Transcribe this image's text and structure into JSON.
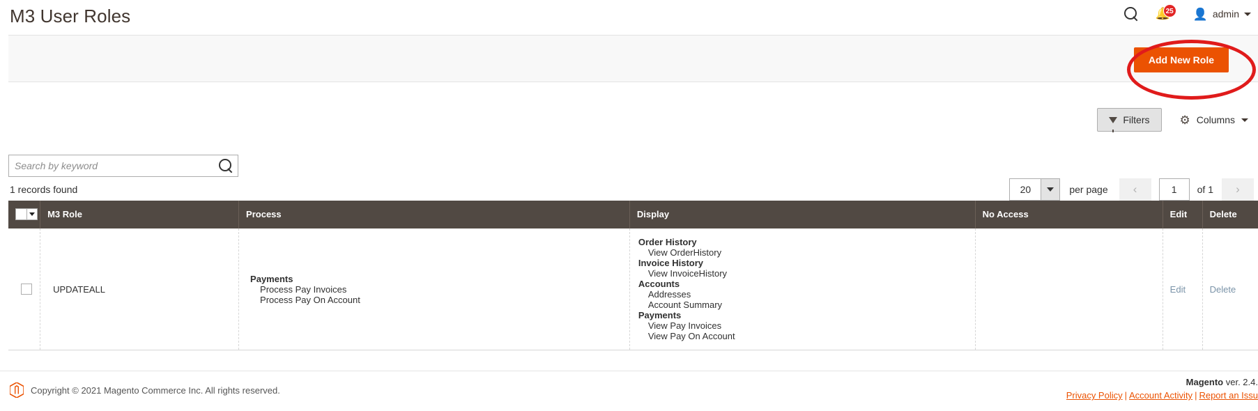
{
  "header": {
    "title": "M3 User Roles",
    "search_icon": "search-icon",
    "notifications": {
      "icon": "bell-icon",
      "count": "25"
    },
    "user": {
      "avatar_icon": "user-avatar-icon",
      "name": "admin",
      "caret_icon": "chevron-down-icon"
    }
  },
  "page_actions": {
    "add_new_role_label": "Add New Role",
    "accent_color": "#eb5202",
    "annotation_color": "#e01b1b"
  },
  "grid_controls": {
    "filters_label": "Filters",
    "filters_icon": "funnel-icon",
    "columns_label": "Columns",
    "columns_icon": "gear-icon",
    "columns_caret_icon": "chevron-down-icon"
  },
  "search": {
    "placeholder": "Search by keyword",
    "value": "",
    "submit_icon": "search-icon"
  },
  "toolbar": {
    "records_found": "1 records found",
    "per_page_value": "20",
    "per_page_label": "per page",
    "prev_icon": "chevron-left-icon",
    "next_icon": "chevron-right-icon",
    "current_page": "1",
    "of_label": "of 1"
  },
  "table": {
    "columns": [
      {
        "key": "checkbox",
        "label": ""
      },
      {
        "key": "role",
        "label": "M3 Role"
      },
      {
        "key": "process",
        "label": "Process"
      },
      {
        "key": "display",
        "label": "Display"
      },
      {
        "key": "no_access",
        "label": "No Access"
      },
      {
        "key": "edit",
        "label": "Edit"
      },
      {
        "key": "delete",
        "label": "Delete"
      }
    ],
    "rows": [
      {
        "role": "UPDATEALL",
        "process": [
          {
            "group": "Payments",
            "items": [
              "Process Pay Invoices",
              "Process Pay On Account"
            ]
          }
        ],
        "display": [
          {
            "group": "Order History",
            "items": [
              "View OrderHistory"
            ]
          },
          {
            "group": "Invoice History",
            "items": [
              "View InvoiceHistory"
            ]
          },
          {
            "group": "Accounts",
            "items": [
              "Addresses",
              "Account Summary"
            ]
          },
          {
            "group": "Payments",
            "items": [
              "View Pay Invoices",
              "View Pay On Account"
            ]
          }
        ],
        "no_access": [],
        "edit_label": "Edit",
        "delete_label": "Delete"
      }
    ]
  },
  "footer": {
    "copyright": "Copyright © 2021 Magento Commerce Inc. All rights reserved.",
    "logo_icon": "magento-logo-icon",
    "version_brand": "Magento",
    "version_text": " ver. 2.4.",
    "links": [
      {
        "label": "Privacy Policy"
      },
      {
        "label": "Account Activity"
      },
      {
        "label": "Report an Issu"
      }
    ],
    "separator": "|"
  }
}
